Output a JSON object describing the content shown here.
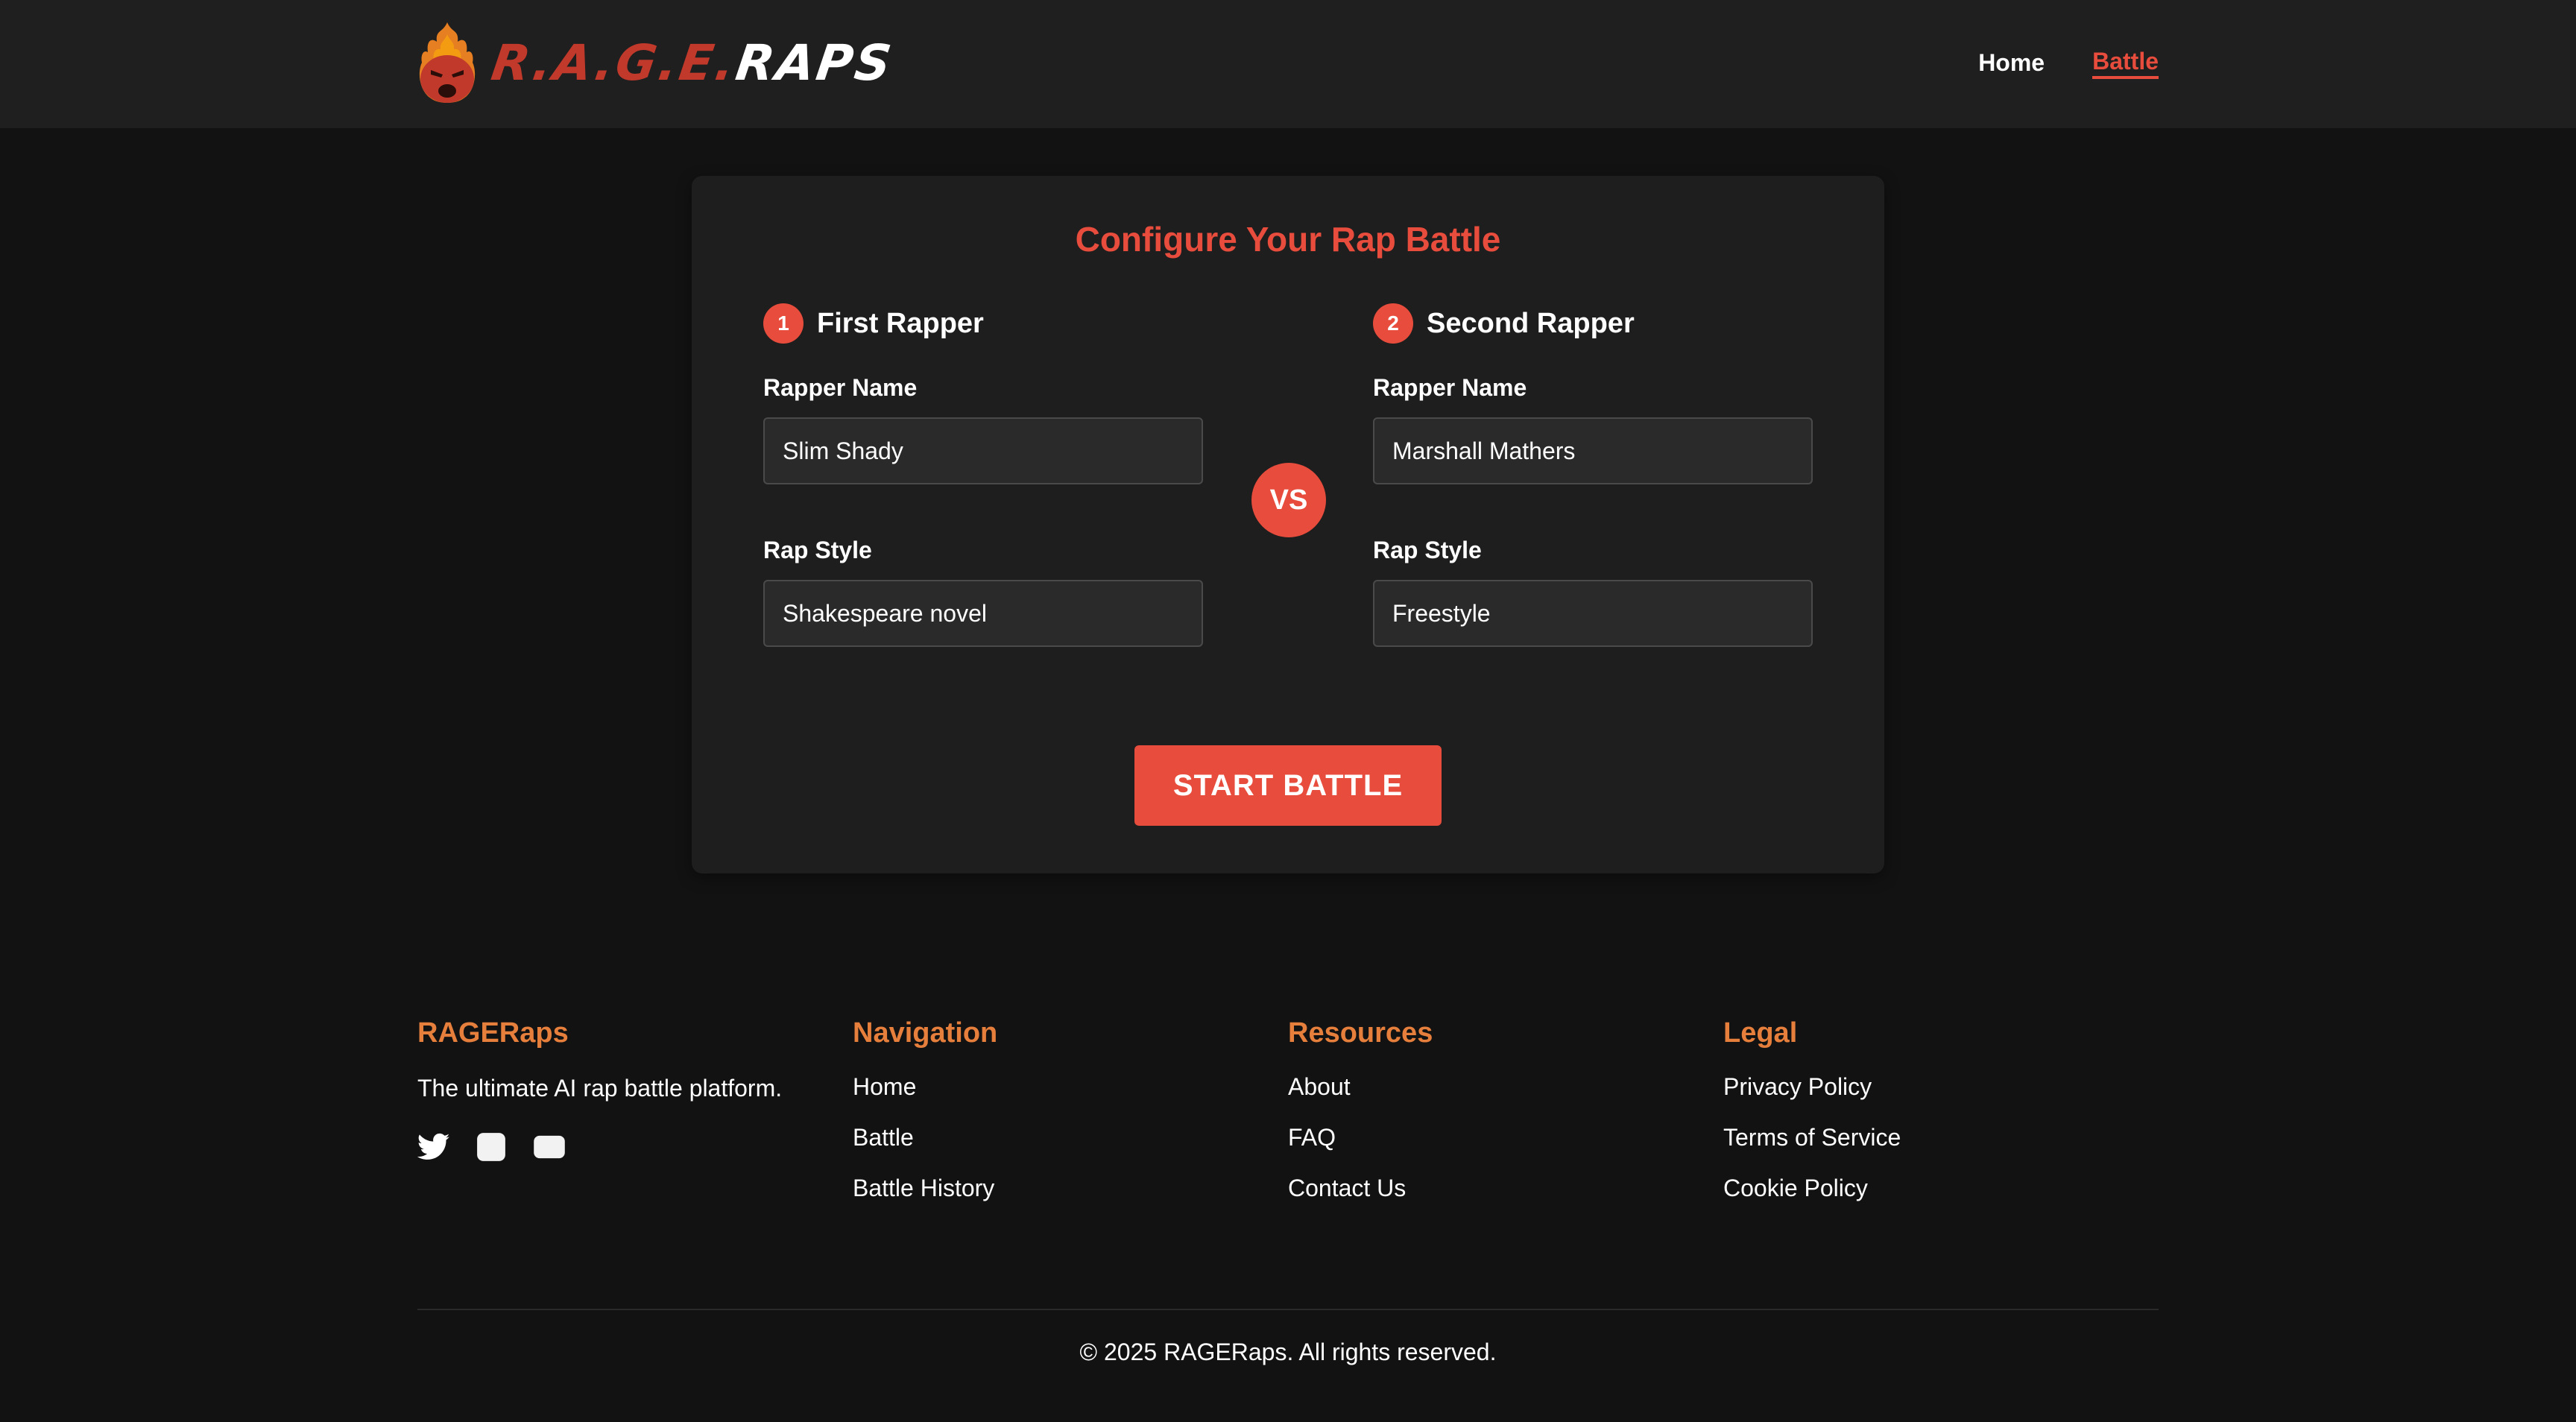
{
  "header": {
    "logo": {
      "rage_text": "R.A.G.E.",
      "raps_text": "RAPS",
      "icon": "flame-face-icon"
    },
    "nav": [
      {
        "label": "Home",
        "active": false
      },
      {
        "label": "Battle",
        "active": true
      }
    ]
  },
  "card": {
    "title": "Configure Your Rap Battle",
    "first": {
      "number": "1",
      "heading": "First Rapper",
      "name_label": "Rapper Name",
      "name_value": "Slim Shady",
      "style_label": "Rap Style",
      "style_value": "Shakespeare novel"
    },
    "vs_label": "VS",
    "second": {
      "number": "2",
      "heading": "Second Rapper",
      "name_label": "Rapper Name",
      "name_value": "Marshall Mathers",
      "style_label": "Rap Style",
      "style_value": "Freestyle"
    },
    "start_label": "START BATTLE"
  },
  "footer": {
    "brand": {
      "heading": "RAGERaps",
      "tagline": "The ultimate AI rap battle platform.",
      "social_icons": [
        "twitter-icon",
        "instagram-icon",
        "youtube-icon"
      ]
    },
    "navigation": {
      "heading": "Navigation",
      "links": [
        "Home",
        "Battle",
        "Battle History"
      ]
    },
    "resources": {
      "heading": "Resources",
      "links": [
        "About",
        "FAQ",
        "Contact Us"
      ]
    },
    "legal": {
      "heading": "Legal",
      "links": [
        "Privacy Policy",
        "Terms of Service",
        "Cookie Policy"
      ]
    },
    "copyright": "© 2025 RAGERaps. All rights reserved."
  },
  "colors": {
    "accent": "#e74c3c",
    "footer_heading": "#e67e3c",
    "background": "#121212",
    "header_bg": "#1f1f1f",
    "card_bg": "#1e1e1e"
  }
}
